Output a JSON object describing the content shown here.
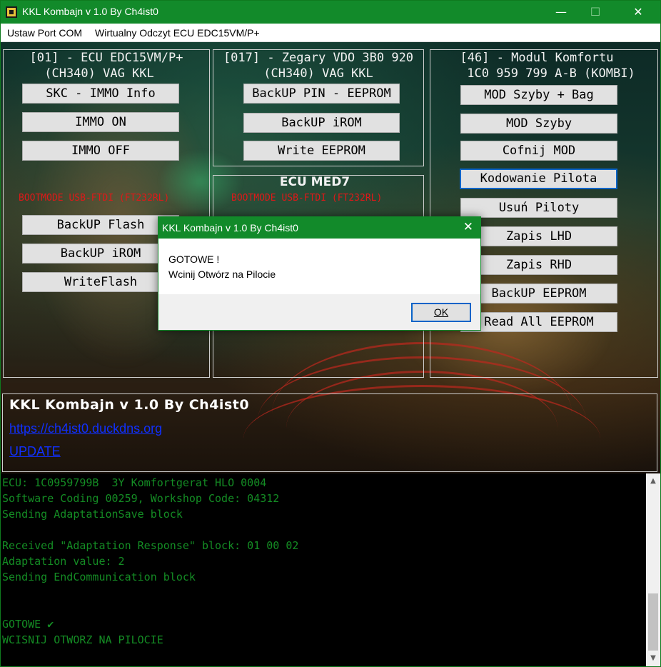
{
  "window": {
    "title": "KKL Kombajn v 1.0 By Ch4ist0",
    "controls": {
      "minimize": "—",
      "maximize": "☐",
      "close": "✕"
    }
  },
  "menu": [
    "Ustaw Port COM",
    "Wirtualny Odczyt ECU EDC15VM/P+"
  ],
  "panels": {
    "ecu": {
      "title_line1": "[01] - ECU EDC15VM/P+",
      "title_line2": "(CH340) VAG KKL",
      "buttons": [
        "SKC - IMMO Info",
        "IMMO ON",
        "IMMO OFF"
      ],
      "bootmode_label": "BOOTMODE USB-FTDI (FT232RL)",
      "boot_buttons": [
        "BackUP Flash",
        "BackUP iROM",
        "WriteFlash"
      ]
    },
    "cluster": {
      "title_line1": "[017] - Zegary VDO 3B0 920",
      "title_line2": "(CH340) VAG KKL",
      "buttons": [
        "BackUP PIN - EEPROM",
        "BackUP iROM",
        "Write EEPROM"
      ]
    },
    "med7": {
      "title": "ECU MED7",
      "bootmode_label": "BOOTMODE USB-FTDI (FT232RL)"
    },
    "comfort": {
      "title_line1": "[46] - Modul Komfortu",
      "title_line2": "1C0 959 799 A-B (KOMBI)",
      "buttons": [
        "MOD Szyby + Bag",
        "MOD Szyby",
        "Cofnij MOD",
        "Kodowanie Pilota",
        "Usuń Piloty",
        "Zapis LHD",
        "Zapis RHD",
        "BackUP EEPROM",
        "Read All EEPROM"
      ]
    }
  },
  "info": {
    "brand": "KKL Kombajn v 1.0 By Ch4ist0",
    "link_site": "https://ch4ist0.duckdns.org",
    "link_update": "UPDATE"
  },
  "console": {
    "lines": [
      "ECU: 1C0959799B  3Y Komfortgerat HLO 0004",
      "Software Coding 00259, Workshop Code: 04312",
      "Sending AdaptationSave block",
      "",
      "Received \"Adaptation Response\" block: 01 00 02",
      "Adaptation value: 2",
      "Sending EndCommunication block",
      "",
      "",
      "GOTOWE ✔",
      "WCISNIJ OTWORZ NA PILOCIE"
    ]
  },
  "dialog": {
    "title": "KKL Kombajn v 1.0 By Ch4ist0",
    "line1": "GOTOWE !",
    "line2": "Wcinij Otwórz na Pilocie",
    "ok_label": "OK",
    "close": "✕"
  },
  "colors": {
    "titlebar": "#128a2a",
    "console_text": "#148c24",
    "bootmode_red": "#e01818",
    "link_blue": "#1030ff",
    "focus_blue": "#0a64c8"
  }
}
